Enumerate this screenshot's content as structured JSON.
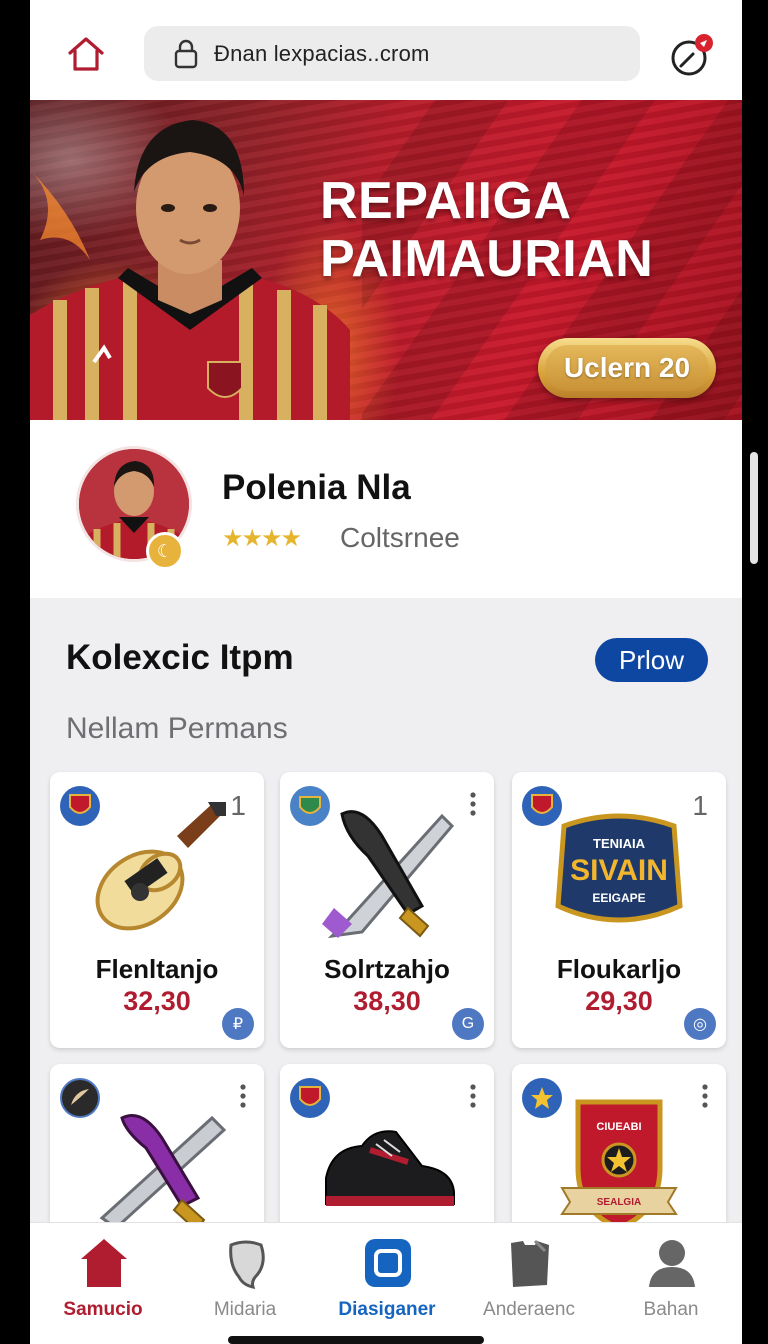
{
  "browser": {
    "url": "Ðnan lexpacias..crom"
  },
  "hero": {
    "title_line1": "REPAIIGA",
    "title_line2": "PAIMAURIAN",
    "badge": "Uclern 20"
  },
  "profile": {
    "name": "Polenia Nla",
    "stars": "★★★★",
    "subtitle": "Coltsrnee"
  },
  "collection": {
    "title": "Kolexcic Itpm",
    "button": "Prlow",
    "subtitle": "Nellam Permans",
    "items": [
      {
        "name": "Flenltanjo",
        "price": "32,30",
        "count": "1",
        "badge": "₽"
      },
      {
        "name": "Solrtzahjo",
        "price": "38,30",
        "count": "",
        "badge": "G"
      },
      {
        "name": "Floukarljo",
        "price": "29,30",
        "count": "1",
        "badge": "◎"
      },
      {
        "name": "",
        "price": "",
        "count": "",
        "badge": ""
      },
      {
        "name": "",
        "price": "",
        "count": "",
        "badge": ""
      },
      {
        "name": "",
        "price": "",
        "count": "",
        "badge": ""
      }
    ],
    "emblem_text": [
      "TENIAIA",
      "SIVAIN",
      "EEIGAPE"
    ],
    "shield_text": [
      "CIUEABI",
      "SEALGIA"
    ]
  },
  "nav": {
    "items": [
      {
        "label": "Samucio"
      },
      {
        "label": "Midaria"
      },
      {
        "label": "Diasiganer"
      },
      {
        "label": "Anderaenc"
      },
      {
        "label": "Bahan"
      }
    ]
  },
  "colors": {
    "brand_red": "#b01c30",
    "accent_blue": "#0d47a1",
    "gold": "#e6b530"
  }
}
